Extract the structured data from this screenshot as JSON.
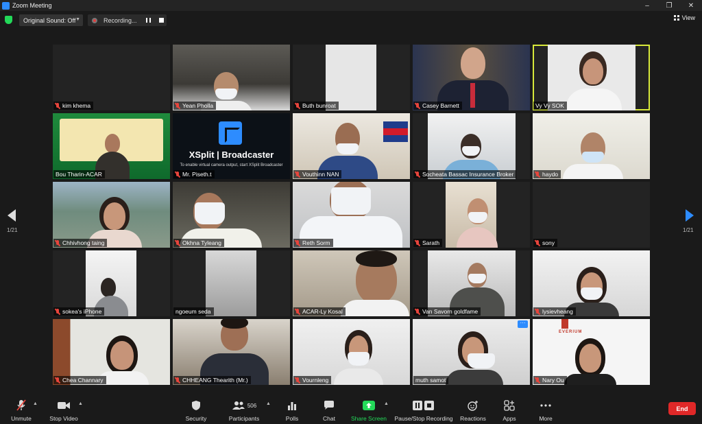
{
  "window": {
    "title": "Zoom Meeting",
    "controls": {
      "minimize": "–",
      "restore": "❐",
      "close": "✕"
    }
  },
  "top_toolbar": {
    "original_sound_label": "Original Sound: Off",
    "recording_label": "Recording...",
    "view_label": "View"
  },
  "pagination": {
    "left": "1/21",
    "right": "1/21"
  },
  "participants": [
    {
      "name": "kim khema",
      "muted": true
    },
    {
      "name": "Yean Pholla",
      "muted": true
    },
    {
      "name": "Buth bunroat",
      "muted": true
    },
    {
      "name": "Casey Barnett",
      "muted": true
    },
    {
      "name": "Vy Vy SOK",
      "muted": false,
      "active_speaker": true
    },
    {
      "name": "Bou Tharin-ACAR",
      "muted": false
    },
    {
      "name": "Mr. Piseth.t",
      "muted": true,
      "overlay_title": "XSplit | Broadcaster",
      "overlay_subtitle": "To enable virtual camera output, start XSplit Broadcaster"
    },
    {
      "name": "Vouthinn NAN",
      "muted": true
    },
    {
      "name": "Socheata Bassac Insurance Broker",
      "muted": true
    },
    {
      "name": "haydo",
      "muted": true
    },
    {
      "name": "Chhivhong taing",
      "muted": true
    },
    {
      "name": "Okhna Tyleang",
      "muted": true
    },
    {
      "name": "Reth Sorm",
      "muted": true
    },
    {
      "name": "Sarath",
      "muted": true
    },
    {
      "name": "sony",
      "muted": true
    },
    {
      "name": "sokea's iPhone",
      "muted": true
    },
    {
      "name": "ngoeum seda",
      "muted": false
    },
    {
      "name": "ACAR-Ly Kosal",
      "muted": true
    },
    {
      "name": "Van Savorn goldfame",
      "muted": true
    },
    {
      "name": "lysievheang",
      "muted": true
    },
    {
      "name": "Chea Channary",
      "muted": true
    },
    {
      "name": "CHHEANG Thearith (Mr.)",
      "muted": true
    },
    {
      "name": "Vournleng",
      "muted": true
    },
    {
      "name": "muth samot",
      "muted": false,
      "more_button": "···"
    },
    {
      "name": "Nary Ou",
      "muted": true,
      "overlay_title": "EVERIUM"
    }
  ],
  "bottom_toolbar": {
    "unmute": "Unmute",
    "stop_video": "Stop Video",
    "security": "Security",
    "participants": "Participants",
    "participants_count": "506",
    "polls": "Polls",
    "chat": "Chat",
    "share_screen": "Share Screen",
    "pause_stop_recording": "Pause/Stop Recording",
    "reactions": "Reactions",
    "apps": "Apps",
    "more": "More",
    "end": "End"
  },
  "colors": {
    "background": "#1a1a1a",
    "accent_blue": "#2d8cff",
    "active_speaker_border": "#d8e93a",
    "share_green": "#23d959",
    "end_red": "#e02828",
    "muted_red": "#e8453c"
  }
}
